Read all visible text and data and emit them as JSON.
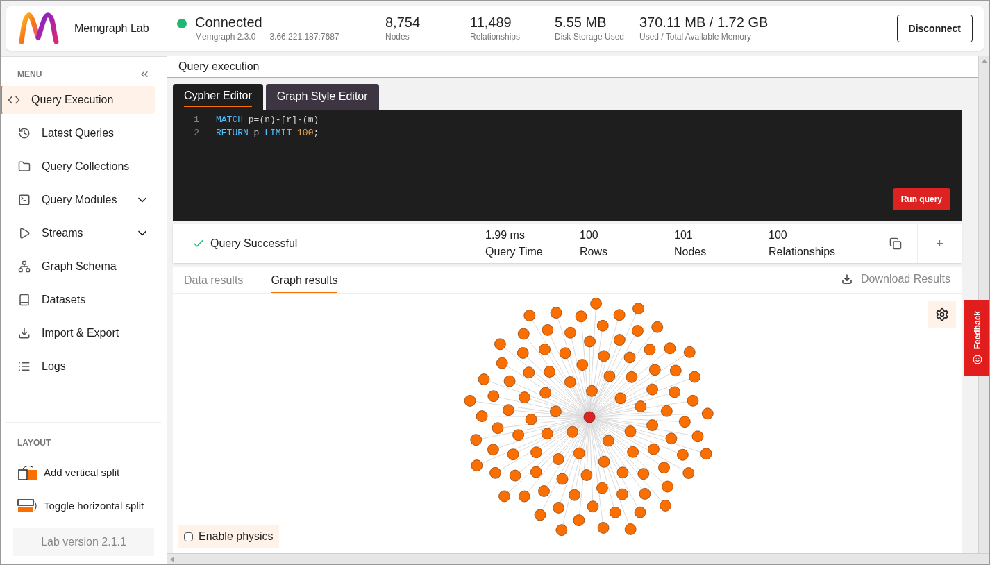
{
  "header": {
    "app_name": "Memgraph Lab",
    "connection": {
      "status": "Connected",
      "connected": true,
      "version": "Memgraph 2.3.0",
      "address": "3.66.221.187:7687"
    },
    "stats": [
      {
        "value": "8,754",
        "label": "Nodes"
      },
      {
        "value": "11,489",
        "label": "Relationships"
      },
      {
        "value": "5.55 MB",
        "label": "Disk Storage Used"
      },
      {
        "value": "370.11 MB / 1.72 GB",
        "label": "Used / Total Available Memory"
      }
    ],
    "disconnect_button": "Disconnect"
  },
  "sidebar": {
    "menu_title": "MENU",
    "items": [
      {
        "label": "Query Execution",
        "selected": true,
        "expandable": false
      },
      {
        "label": "Latest Queries",
        "selected": false,
        "expandable": false
      },
      {
        "label": "Query Collections",
        "selected": false,
        "expandable": false
      },
      {
        "label": "Query Modules",
        "selected": false,
        "expandable": true
      },
      {
        "label": "Streams",
        "selected": false,
        "expandable": true
      },
      {
        "label": "Graph Schema",
        "selected": false,
        "expandable": false
      },
      {
        "label": "Datasets",
        "selected": false,
        "expandable": false
      },
      {
        "label": "Import & Export",
        "selected": false,
        "expandable": false
      },
      {
        "label": "Logs",
        "selected": false,
        "expandable": false
      }
    ],
    "layout_title": "LAYOUT",
    "layout_items": [
      "Add vertical split",
      "Toggle horizontal split"
    ],
    "version": "Lab version 2.1.1"
  },
  "page_title": "Query execution",
  "editor_tabs": [
    {
      "label": "Cypher Editor",
      "selected": true
    },
    {
      "label": "Graph Style Editor",
      "selected": false
    }
  ],
  "code_lines": [
    {
      "number": "1",
      "tokens": [
        {
          "kind": "keyword",
          "text": "MATCH"
        },
        {
          "kind": "plain",
          "text": " p=(n)-[r]-(m)"
        }
      ]
    },
    {
      "number": "2",
      "tokens": [
        {
          "kind": "keyword",
          "text": "RETURN"
        },
        {
          "kind": "plain",
          "text": " p "
        },
        {
          "kind": "keyword",
          "text": "LIMIT"
        },
        {
          "kind": "number",
          "text": " 100"
        },
        {
          "kind": "plain",
          "text": ";"
        }
      ]
    }
  ],
  "run_button": "Run query",
  "result_summary": {
    "status": "Query Successful",
    "metrics": [
      {
        "value": "1.99 ms",
        "label": "Query Time"
      },
      {
        "value": "100",
        "label": "Rows"
      },
      {
        "value": "101",
        "label": "Nodes"
      },
      {
        "value": "100",
        "label": "Relationships"
      }
    ],
    "add_button": "+"
  },
  "result_tabs": [
    {
      "label": "Data results",
      "selected": false
    },
    {
      "label": "Graph results",
      "selected": true
    }
  ],
  "download_button": "Download Results",
  "enable_physics": {
    "label": "Enable physics",
    "checked": false
  },
  "feedback_tab": "Feedback"
}
